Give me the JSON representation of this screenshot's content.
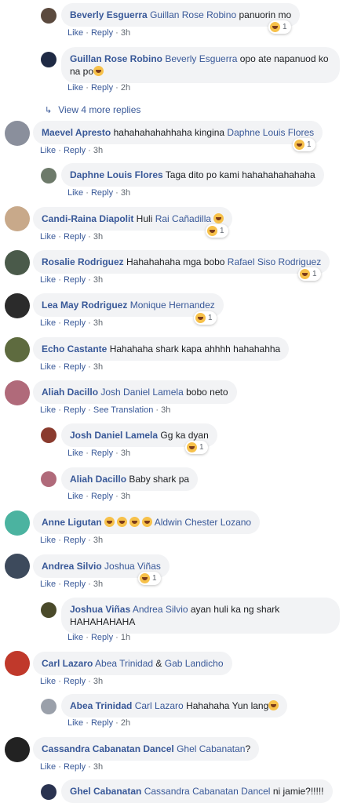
{
  "meta": {
    "like": "Like",
    "reply": "Reply",
    "see_translation": "See Translation",
    "dot": "·"
  },
  "view_more": "View 4 more replies",
  "comments": [
    {
      "name": "Beverly Esguerra",
      "tag": "Guillan Rose Robino",
      "text": " panuorin mo",
      "time": "3h",
      "react": "1"
    },
    {
      "name": "Guillan Rose Robino",
      "tag": "Beverly Esguerra",
      "text": " opo ate napanuod ko na po",
      "time": "2h"
    },
    {
      "name": "Maevel Apresto",
      "pre": " hahahahahahhaha kingina ",
      "tag": "Daphne Louis Flores",
      "time": "3h",
      "react": "1"
    },
    {
      "name": "Daphne Louis Flores",
      "text": " Taga dito po kami hahahahahahaha",
      "time": "3h"
    },
    {
      "name": "Candi-Raina Diapolit",
      "pre": " Huli ",
      "tag": "Rai Cañadilla",
      "time": "3h",
      "react": "1"
    },
    {
      "name": "Rosalie Rodriguez",
      "pre": " Hahahahaha mga bobo ",
      "tag": "Rafael Siso Rodriguez",
      "time": "3h",
      "react": "1"
    },
    {
      "name": "Lea May Rodriguez",
      "tag": "Monique Hernandez",
      "time": "3h",
      "react": "1"
    },
    {
      "name": "Echo Castante",
      "text": " Hahahaha shark kapa ahhhh hahahahha",
      "time": "3h"
    },
    {
      "name": "Aliah Dacillo",
      "tag": "Josh Daniel Lamela",
      "text": " bobo neto",
      "time": "3h"
    },
    {
      "name": "Josh Daniel Lamela",
      "text": " Gg ka dyan",
      "time": "3h",
      "react": "1"
    },
    {
      "name": "Aliah Dacillo",
      "text": " Baby shark pa",
      "time": "3h"
    },
    {
      "name": "Anne Ligutan",
      "tag": "Aldwin Chester Lozano",
      "time": "3h"
    },
    {
      "name": "Andrea Silvio",
      "tag": "Joshua Viñas",
      "time": "3h",
      "react": "1"
    },
    {
      "name": "Joshua Viñas",
      "tag": "Andrea Silvio",
      "text": " ayan huli ka ng shark HAHAHAHAHA",
      "time": "1h"
    },
    {
      "name": "Carl Lazaro",
      "tag": "Abea Trinidad",
      "mid": " & ",
      "tag2": "Gab Landicho",
      "time": "3h"
    },
    {
      "name": "Abea Trinidad",
      "tag": "Carl Lazaro",
      "text": " Hahahaha Yun lang",
      "time": "2h"
    },
    {
      "name": "Cassandra Cabanatan Dancel",
      "tag": "Ghel Cabanatan",
      "text": "?",
      "time": "3h"
    },
    {
      "name": "Ghel Cabanatan",
      "tag": "Cassandra Cabanatan Dancel",
      "text": " ni jamie?!!!!!"
    }
  ],
  "colors": {
    "name": "#385898",
    "bubble": "#f2f3f5",
    "meta": "#606770"
  }
}
